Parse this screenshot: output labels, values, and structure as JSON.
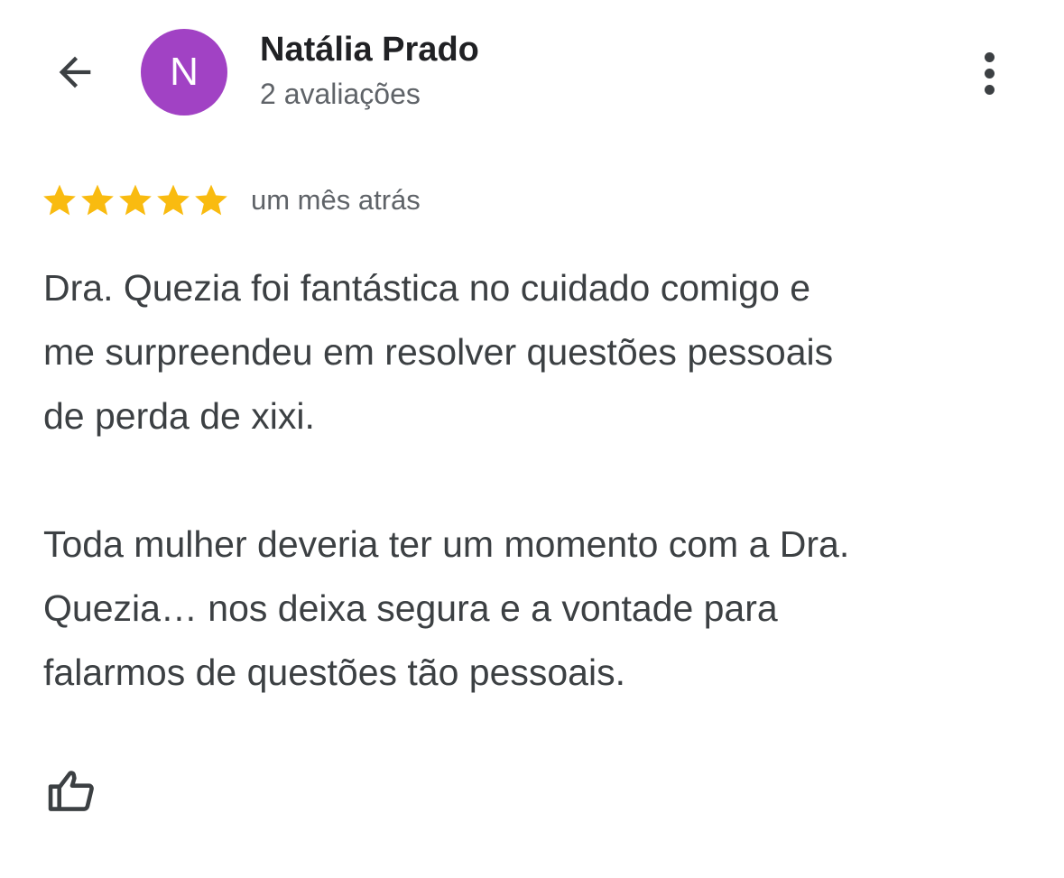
{
  "header": {
    "back_icon": "arrow-back-icon",
    "avatar_letter": "N",
    "avatar_color": "#a142c4",
    "user_name": "Natália Prado",
    "review_count": "2 avaliações",
    "more_icon": "more-vert-icon"
  },
  "review": {
    "rating": 5,
    "max_rating": 5,
    "star_color": "#f9bb10",
    "star_icon": "star-icon",
    "time_ago": "um mês atrás",
    "paragraph_1": {
      "line_1": "Dra. Quezia foi fantástica no cuidado comigo e",
      "line_2": "me surpreendeu em resolver questões pessoais",
      "line_3": "de perda de xixi."
    },
    "paragraph_2": {
      "line_1": "Toda mulher deveria ter um momento com a Dra.",
      "line_2": "Quezia… nos deixa segura e a vontade para",
      "line_3": "falarmos de questões tão pessoais."
    }
  },
  "actions": {
    "like_icon": "thumb-up-icon"
  }
}
